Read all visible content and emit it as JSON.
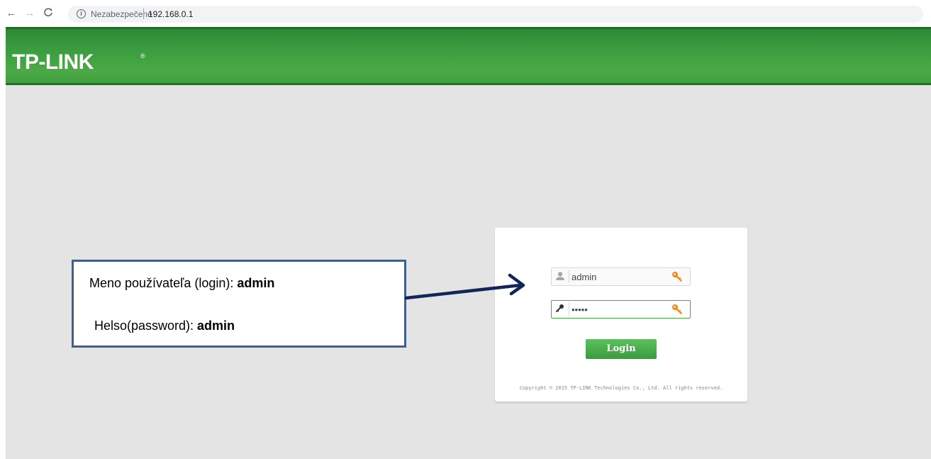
{
  "browser": {
    "back_icon": "arrow-left-icon",
    "forward_icon": "arrow-right-icon",
    "reload_icon": "reload-icon",
    "security_status": "Nezabezpečené",
    "url": "192.168.0.1"
  },
  "header": {
    "brand": "TP-LINK",
    "brand_mark": "®",
    "color": "#3f9c3b"
  },
  "login": {
    "username_value": "admin",
    "password_value": "admin",
    "button_label": "Login",
    "copyright": "Copyright © 2015 TP-LINK Technologies Co., Ltd. All rights reserved.",
    "accent_color": "#48a64b",
    "key_icon_color": "#f08a1c"
  },
  "annotation": {
    "line1_label": "Meno používateľa (login): ",
    "line1_value": "admin",
    "line2_label": "Helso(password): ",
    "line2_value": "admin",
    "border_color": "#3f5f8f",
    "arrow_color": "#13245a"
  }
}
